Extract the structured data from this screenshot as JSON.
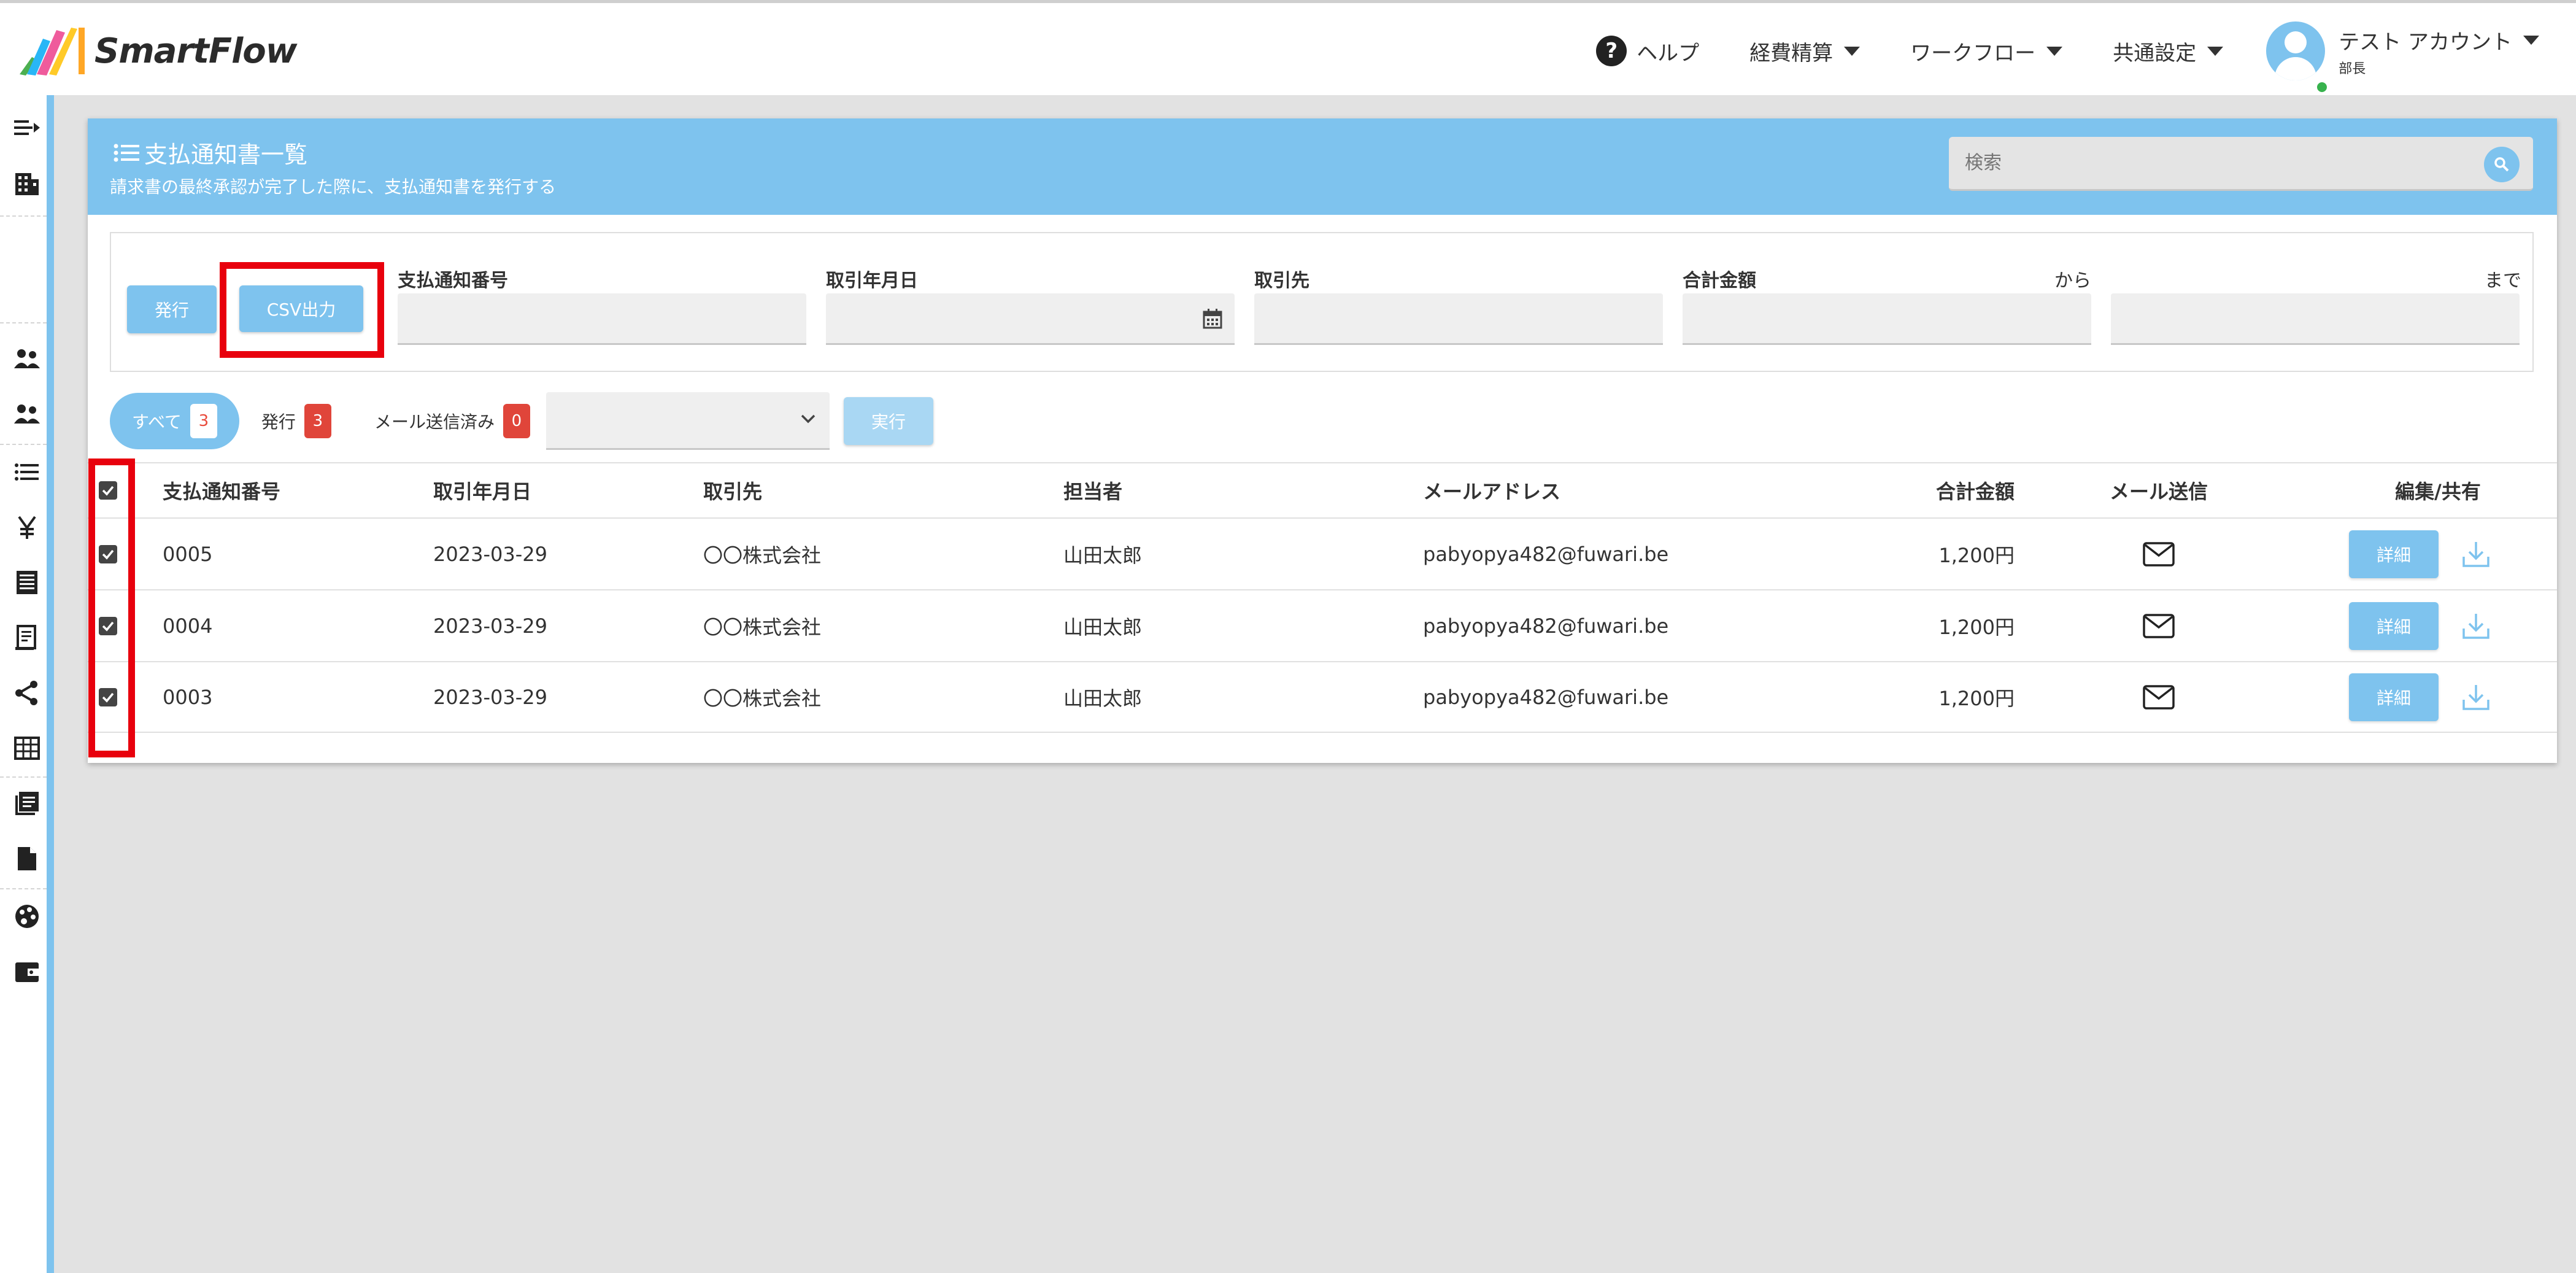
{
  "brand": {
    "name": "SmartFlow"
  },
  "nav": {
    "help": "ヘルプ",
    "expense": "経費精算",
    "workflow": "ワークフロー",
    "common_settings": "共通設定",
    "account_name": "テスト アカウント",
    "account_role": "部長"
  },
  "sidebar": {
    "icons": [
      "collapse-icon",
      "building-icon",
      "users-icon",
      "user-group-icon",
      "list-icon",
      "yen-icon",
      "ledger-icon",
      "receipt-icon",
      "share-icon",
      "table-icon",
      "book-icon",
      "document-icon",
      "palette-icon",
      "wallet-icon"
    ]
  },
  "page": {
    "title": "支払通知書一覧",
    "subtitle": "請求書の最終承認が完了した際に、支払通知書を発行する",
    "search_placeholder": "検索"
  },
  "filters": {
    "issue_button": "発行",
    "csv_button": "CSV出力",
    "notice_number_label": "支払通知番号",
    "trade_date_label": "取引年月日",
    "partner_label": "取引先",
    "total_label": "合計金額",
    "from_label": "から",
    "to_label": "まで"
  },
  "tabs": {
    "all_label": "すべて",
    "all_count": "3",
    "issued_label": "発行",
    "issued_count": "3",
    "mailed_label": "メール送信済み",
    "mailed_count": "0",
    "execute_button": "実行"
  },
  "table": {
    "headers": {
      "number": "支払通知番号",
      "date": "取引年月日",
      "partner": "取引先",
      "person": "担当者",
      "email": "メールアドレス",
      "total": "合計金額",
      "mail": "メール送信",
      "edit": "編集/共有"
    },
    "rows": [
      {
        "number": "0005",
        "date": "2023-03-29",
        "partner": "〇〇株式会社",
        "person": "山田太郎",
        "email": "pabyopya482@fuwari.be",
        "total": "1,200円",
        "detail": "詳細"
      },
      {
        "number": "0004",
        "date": "2023-03-29",
        "partner": "〇〇株式会社",
        "person": "山田太郎",
        "email": "pabyopya482@fuwari.be",
        "total": "1,200円",
        "detail": "詳細"
      },
      {
        "number": "0003",
        "date": "2023-03-29",
        "partner": "〇〇株式会社",
        "person": "山田太郎",
        "email": "pabyopya482@fuwari.be",
        "total": "1,200円",
        "detail": "詳細"
      }
    ]
  },
  "colors": {
    "accent": "#7ec3ee",
    "highlight": "#e8000d",
    "badge_red": "#e0453a"
  }
}
